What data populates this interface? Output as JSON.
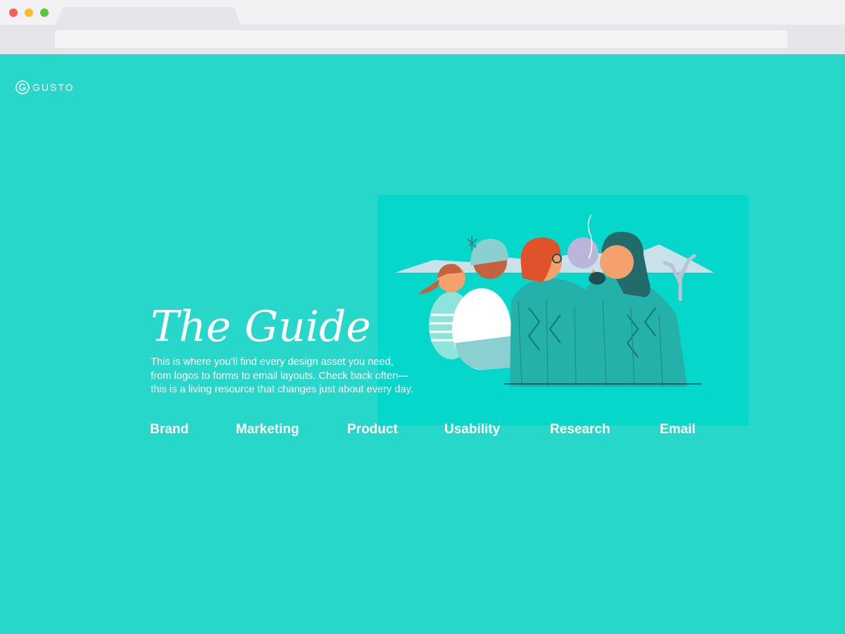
{
  "brand": {
    "name": "GUSTO"
  },
  "hero": {
    "title": "The Guide",
    "description": [
      "This is where you’ll find every design asset you need,",
      "from logos to forms to email layouts. Check back often—",
      "this is a living resource that changes just about every day."
    ]
  },
  "nav": {
    "items": [
      {
        "label": "Brand"
      },
      {
        "label": "Marketing"
      },
      {
        "label": "Product"
      },
      {
        "label": "Usability"
      },
      {
        "label": "Research"
      },
      {
        "label": "Email"
      }
    ]
  },
  "colors": {
    "background": "#27d8ca",
    "illustration_bg": "#05d7cb",
    "text": "#ffffff"
  }
}
